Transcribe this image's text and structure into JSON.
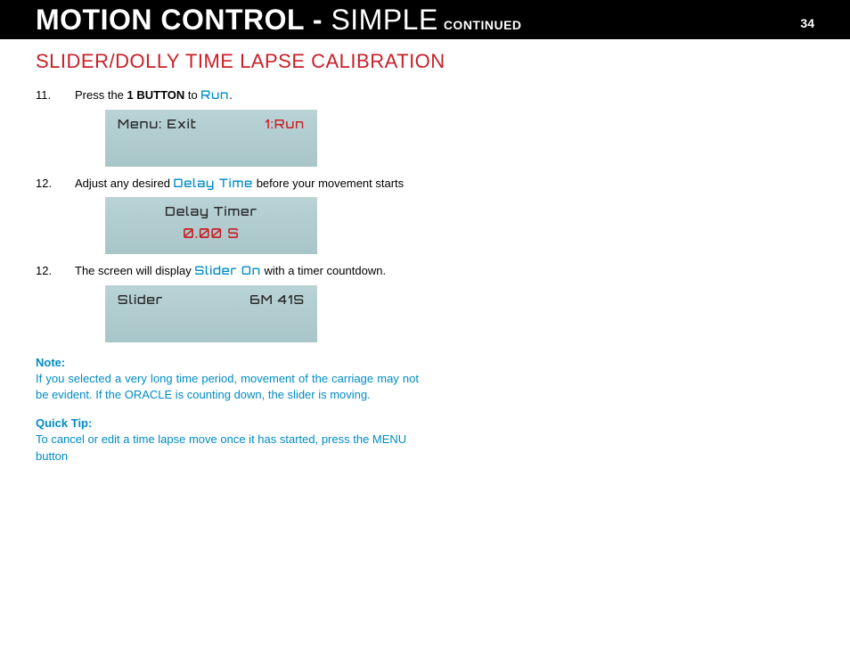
{
  "header": {
    "title_main": "MOTION CONTROL - ",
    "title_light": "SIMPLE",
    "title_sub": "CONTINUED",
    "page_number": "34"
  },
  "section_title": "SLIDER/DOLLY TIME LAPSE CALIBRATION",
  "steps": {
    "s11": {
      "num": "11.",
      "pre": "Press the ",
      "bold": "1 BUTTON",
      "mid": " to ",
      "lcd": "Run",
      "post": "."
    },
    "s12a": {
      "num": "12.",
      "pre": "Adjust any desired ",
      "lcd": "Delay Time",
      "post": " before your movement starts"
    },
    "s12b": {
      "num": "12.",
      "pre": "The screen will display ",
      "lcd": "Slider On",
      "post": " with a timer countdown."
    }
  },
  "screens": {
    "screen1": {
      "left": "Menu: Exit",
      "right": "1:Run"
    },
    "screen2": {
      "title": "Delay Timer",
      "value": "0.00 S"
    },
    "screen3": {
      "left": "Slider",
      "right": "6M 41S"
    }
  },
  "notes": {
    "note1_label": "Note:",
    "note1_text": "If you selected a very long time period, movement of the carriage may not be evident. If the ORACLE is counting down, the slider is moving.",
    "note2_label": "Quick Tip:",
    "note2_text": "To cancel or edit a time lapse move once it has started, press the MENU button"
  }
}
